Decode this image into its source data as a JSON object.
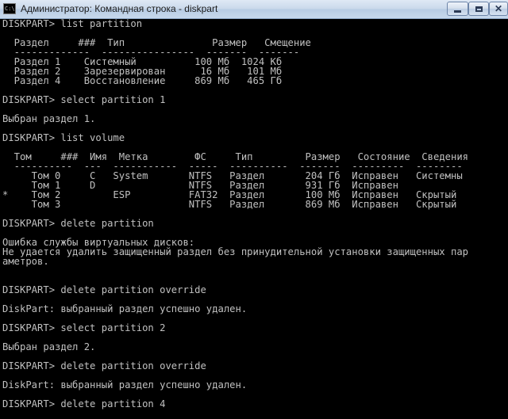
{
  "window": {
    "title": "Администратор: Командная строка - diskpart",
    "icon_label": "C:\\",
    "buttons": {
      "minimize": "minimize-icon",
      "maximize": "maximize-icon",
      "close": "close-icon"
    }
  },
  "console": {
    "foreground": "#c0c0c0",
    "background": "#000000",
    "lines": [
      "DISKPART> list partition",
      "",
      "  Раздел     ###  Тип               Размер   Смещение",
      "  -------------  ----------------  -------  -------",
      "  Раздел 1    Системный          100 Мб  1024 Кб",
      "  Раздел 2    Зарезервирован      16 Мб   101 Мб",
      "  Раздел 4    Восстановление     869 Мб   465 Гб",
      "",
      "DISKPART> select partition 1",
      "",
      "Выбран раздел 1.",
      "",
      "DISKPART> list volume",
      "",
      "  Том     ###  Имя  Метка        ФС     Тип         Размер   Состояние  Сведения",
      "  ----------  ---  -----------  -----  ----------  -------  ---------  --------",
      "     Том 0     C   System       NTFS   Раздел       204 Гб  Исправен   Системны",
      "     Том 1     D                NTFS   Раздел       931 Гб  Исправен",
      "*    Том 2         ESP          FAT32  Раздел       100 Мб  Исправен   Скрытый",
      "     Том 3                      NTFS   Раздел       869 Мб  Исправен   Скрытый",
      "",
      "DISKPART> delete partition",
      "",
      "Ошибка службы виртуальных дисков:",
      "Не удается удалить защищенный раздел без принудительной установки защищенных пар",
      "аметров.",
      "",
      "",
      "DISKPART> delete partition override",
      "",
      "DiskPart: выбранный раздел успешно удален.",
      "",
      "DISKPART> select partition 2",
      "",
      "Выбран раздел 2.",
      "",
      "DISKPART> delete partition override",
      "",
      "DiskPart: выбранный раздел успешно удален.",
      "",
      "DISKPART> delete partition 4"
    ]
  }
}
